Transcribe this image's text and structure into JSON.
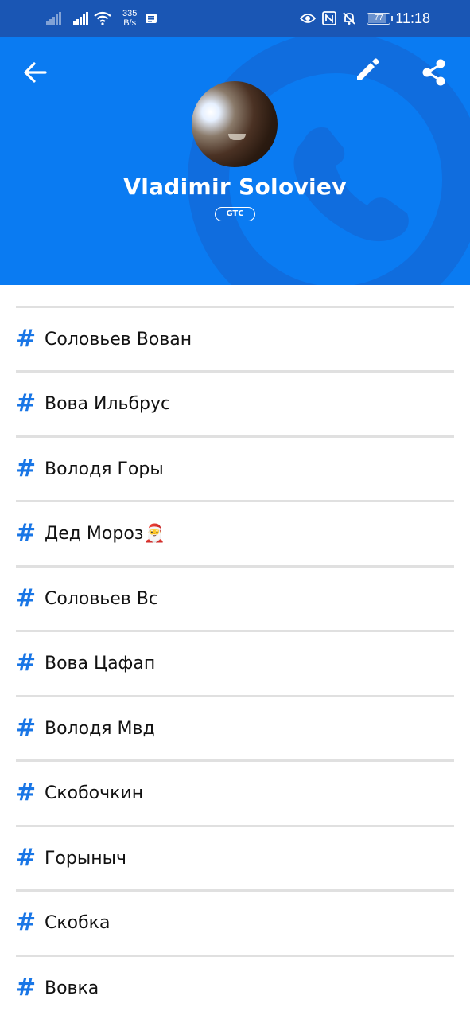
{
  "status_bar": {
    "net_speed_value": "335",
    "net_speed_unit": "B/s",
    "battery": "77",
    "battery_level": 0.77,
    "time": "11:18",
    "icons": [
      "signal-icon",
      "signal-icon",
      "wifi-icon",
      "message-icon",
      "eye-icon",
      "nfc-icon",
      "bell-off-icon",
      "battery-icon"
    ]
  },
  "header": {
    "name": "Vladimir Soloviev",
    "badge": "GTC",
    "background_color": "#0a7bf2",
    "accent_color": "#1976e6",
    "icons": [
      "back-arrow-icon",
      "edit-pencil-icon",
      "share-icon"
    ]
  },
  "tags": [
    {
      "label": "Соловьев Вован"
    },
    {
      "label": "Вова Ильбрус"
    },
    {
      "label": "Володя Горы"
    },
    {
      "label": "Дед Мороз🎅"
    },
    {
      "label": "Соловьев Вс"
    },
    {
      "label": "Вова Цафап"
    },
    {
      "label": "Володя Мвд"
    },
    {
      "label": "Скобочкин"
    },
    {
      "label": "Горыныч"
    },
    {
      "label": "Скобка"
    },
    {
      "label": "Вовка"
    }
  ]
}
